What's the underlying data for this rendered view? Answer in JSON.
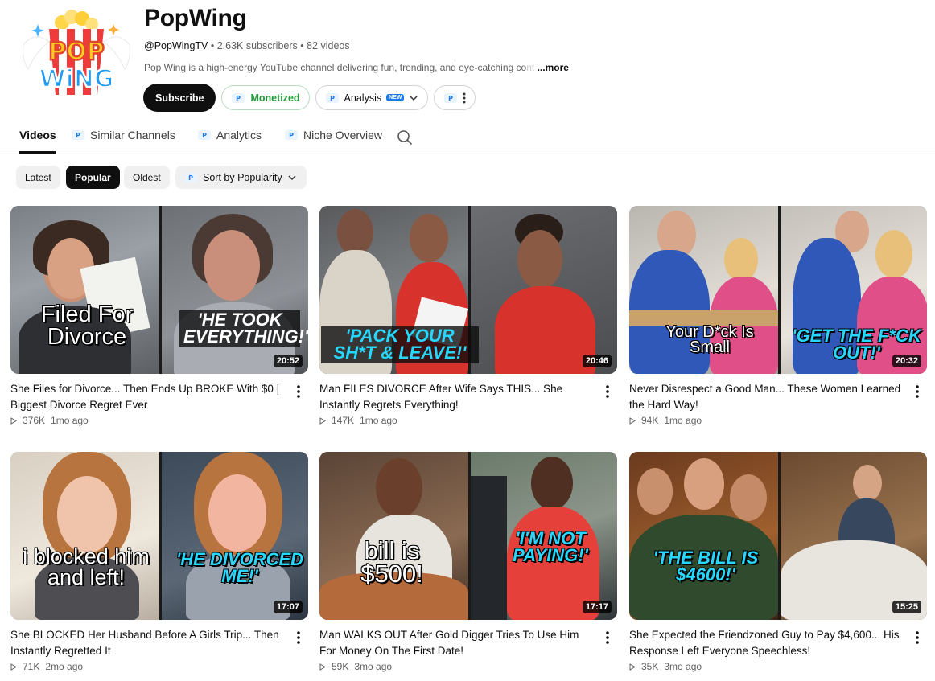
{
  "channel": {
    "name": "PopWing",
    "handle": "@PopWingTV",
    "stats": " • 2.63K subscribers • 82 videos",
    "description": "Pop Wing is a high-energy YouTube channel delivering fun, trending, and eye-catching co",
    "description_fade": "nt",
    "more_label": "...more",
    "logo_text_top": "POP",
    "logo_text_bottom": "WiNG"
  },
  "actions": {
    "subscribe_label": "Subscribe",
    "monetized_label": "Monetized",
    "analysis_label": "Analysis",
    "analysis_badge": "NEW"
  },
  "tabs": [
    {
      "label": "Videos"
    },
    {
      "label": "Similar Channels"
    },
    {
      "label": "Analytics"
    },
    {
      "label": "Niche Overview"
    }
  ],
  "filters": {
    "latest": "Latest",
    "popular": "Popular",
    "oldest": "Oldest",
    "sort_label": "Sort by Popularity",
    "selected": "Popular"
  },
  "colors": {
    "accent_green": "#1f9b3a",
    "caption_cyan": "#27d7ff",
    "badge_blue": "#1d7be8"
  },
  "videos": [
    {
      "title": "She Files for Divorce... Then Ends Up BROKE With $0 | Biggest Divorce Regret Ever",
      "views": "376K",
      "age": "1mo ago",
      "duration": "20:52",
      "caption_left": "Filed For Divorce",
      "caption_right": "'HE TOOK EVERYTHING!'"
    },
    {
      "title": "Man FILES DIVORCE After Wife Says THIS... She Instantly Regrets Everything!",
      "views": "147K",
      "age": "1mo ago",
      "duration": "20:46",
      "caption_left": "",
      "caption_right": "'PACK YOUR SH*T & LEAVE!'"
    },
    {
      "title": "Never Disrespect a Good Man... These Women Learned the Hard Way!",
      "views": "94K",
      "age": "1mo ago",
      "duration": "20:32",
      "caption_left": "Your D*ck Is Small",
      "caption_right": "'GET THE F*CK OUT!'"
    },
    {
      "title": "She BLOCKED Her Husband Before A Girls Trip... Then Instantly Regretted It",
      "views": "71K",
      "age": "2mo ago",
      "duration": "17:07",
      "caption_left": "i blocked him and left!",
      "caption_right": "'HE DIVORCED ME!'"
    },
    {
      "title": "Man WALKS OUT After Gold Digger Tries To Use Him For Money On The First Date!",
      "views": "59K",
      "age": "3mo ago",
      "duration": "17:17",
      "caption_left": "bill is $500!",
      "caption_right": "'I'M NOT PAYING!'"
    },
    {
      "title": "She Expected the Friendzoned Guy to Pay $4,600... His Response Left Everyone Speechless!",
      "views": "35K",
      "age": "3mo ago",
      "duration": "15:25",
      "caption_left": "",
      "caption_right": "'THE BILL IS $4600!'"
    }
  ]
}
